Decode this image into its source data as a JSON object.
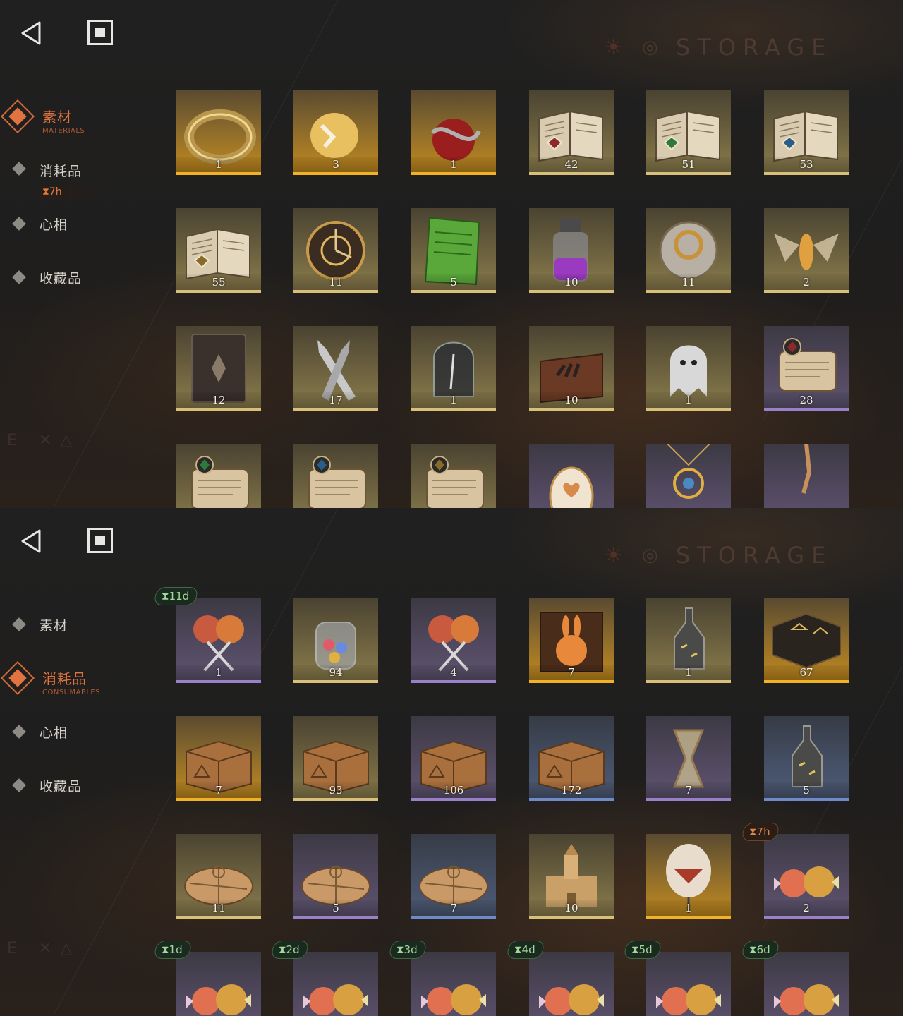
{
  "panels": [
    {
      "header": {
        "title": "STORAGE"
      },
      "nav": [
        {
          "label": "素材",
          "sub": "MATERIALS",
          "active": true
        },
        {
          "label": "消耗品",
          "active": false,
          "timer": "⧗7h"
        },
        {
          "label": "心相",
          "active": false
        },
        {
          "label": "收藏品",
          "active": false
        }
      ],
      "items": [
        {
          "name": "gold-ring",
          "count": "1",
          "quality": "orange"
        },
        {
          "name": "cracked-golden-bird",
          "count": "3",
          "quality": "orange"
        },
        {
          "name": "apple-with-serpent",
          "count": "1",
          "quality": "orange"
        },
        {
          "name": "tome-red-sigil",
          "count": "42",
          "quality": "gold"
        },
        {
          "name": "tome-green-sigil",
          "count": "51",
          "quality": "gold"
        },
        {
          "name": "tome-blue-sigil",
          "count": "53",
          "quality": "gold"
        },
        {
          "name": "tome-gold-sigil",
          "count": "55",
          "quality": "gold"
        },
        {
          "name": "clockwork-astrolabe",
          "count": "11",
          "quality": "gold"
        },
        {
          "name": "green-tablet",
          "count": "5",
          "quality": "gold"
        },
        {
          "name": "purple-potion-flask",
          "count": "10",
          "quality": "gold"
        },
        {
          "name": "brass-pocket-watch",
          "count": "11",
          "quality": "gold"
        },
        {
          "name": "glowing-moth",
          "count": "2",
          "quality": "gold"
        },
        {
          "name": "dark-grimoire",
          "count": "12",
          "quality": "gold"
        },
        {
          "name": "crossed-bullets",
          "count": "17",
          "quality": "gold"
        },
        {
          "name": "bell-jar-feather",
          "count": "1",
          "quality": "gold"
        },
        {
          "name": "box-of-hands",
          "count": "10",
          "quality": "gold"
        },
        {
          "name": "ghost-figure",
          "count": "1",
          "quality": "gold"
        },
        {
          "name": "scroll-red-sigil",
          "count": "28",
          "quality": "purple"
        },
        {
          "name": "scroll-green-sigil",
          "count": "",
          "quality": "gold"
        },
        {
          "name": "scroll-blue-sigil",
          "count": "",
          "quality": "gold"
        },
        {
          "name": "scroll-gold-sigil",
          "count": "",
          "quality": "gold"
        },
        {
          "name": "heart-egg",
          "count": "",
          "quality": "purple"
        },
        {
          "name": "sun-pendant",
          "count": "",
          "quality": "purple"
        },
        {
          "name": "chain-relic",
          "count": "",
          "quality": "purple"
        }
      ]
    },
    {
      "header": {
        "title": "STORAGE"
      },
      "nav": [
        {
          "label": "素材",
          "active": false
        },
        {
          "label": "消耗品",
          "sub": "CONSUMABLES",
          "active": true
        },
        {
          "label": "心相",
          "active": false
        },
        {
          "label": "收藏品",
          "active": false
        }
      ],
      "items": [
        {
          "name": "lollipops",
          "count": "1",
          "quality": "purple",
          "timer": "⧗11d",
          "timer_color": "green"
        },
        {
          "name": "candy-jar",
          "count": "94",
          "quality": "gold"
        },
        {
          "name": "lollipops",
          "count": "4",
          "quality": "purple"
        },
        {
          "name": "rabbit-figurine-box",
          "count": "7",
          "quality": "orange"
        },
        {
          "name": "message-bottle",
          "count": "1",
          "quality": "gold"
        },
        {
          "name": "rune-table",
          "count": "67",
          "quality": "orange"
        },
        {
          "name": "wooden-crate",
          "count": "7",
          "quality": "orange"
        },
        {
          "name": "wooden-crate",
          "count": "93",
          "quality": "gold"
        },
        {
          "name": "wooden-crate",
          "count": "106",
          "quality": "purple"
        },
        {
          "name": "wooden-crate",
          "count": "172",
          "quality": "blue"
        },
        {
          "name": "hourglass",
          "count": "7",
          "quality": "purple"
        },
        {
          "name": "message-bottle",
          "count": "5",
          "quality": "blue"
        },
        {
          "name": "paper-parcel",
          "count": "11",
          "quality": "gold"
        },
        {
          "name": "paper-parcel",
          "count": "5",
          "quality": "purple"
        },
        {
          "name": "paper-parcel",
          "count": "7",
          "quality": "blue"
        },
        {
          "name": "sandcastle",
          "count": "10",
          "quality": "gold"
        },
        {
          "name": "balloon-ornament",
          "count": "1",
          "quality": "orange"
        },
        {
          "name": "wrapped-candies",
          "count": "2",
          "quality": "purple",
          "timer": "⧗7h",
          "timer_color": "orange"
        },
        {
          "name": "wrapped-candies",
          "count": "",
          "quality": "purple",
          "timer": "⧗1d",
          "timer_color": "green"
        },
        {
          "name": "wrapped-candies",
          "count": "",
          "quality": "purple",
          "timer": "⧗2d",
          "timer_color": "green"
        },
        {
          "name": "wrapped-candies",
          "count": "",
          "quality": "purple",
          "timer": "⧗3d",
          "timer_color": "green"
        },
        {
          "name": "wrapped-candies",
          "count": "",
          "quality": "purple",
          "timer": "⧗4d",
          "timer_color": "green"
        },
        {
          "name": "wrapped-candies",
          "count": "",
          "quality": "purple",
          "timer": "⧗5d",
          "timer_color": "green"
        },
        {
          "name": "wrapped-candies",
          "count": "",
          "quality": "purple",
          "timer": "⧗6d",
          "timer_color": "green"
        }
      ]
    }
  ],
  "icons": {
    "back": "back-arrow-icon",
    "home": "home-square-icon"
  },
  "colors": {
    "accent": "#e0733f",
    "orange_quality": "#f2b226",
    "gold_quality": "#d8c07a",
    "purple_quality": "#9a80c8",
    "blue_quality": "#6e8ac8"
  }
}
